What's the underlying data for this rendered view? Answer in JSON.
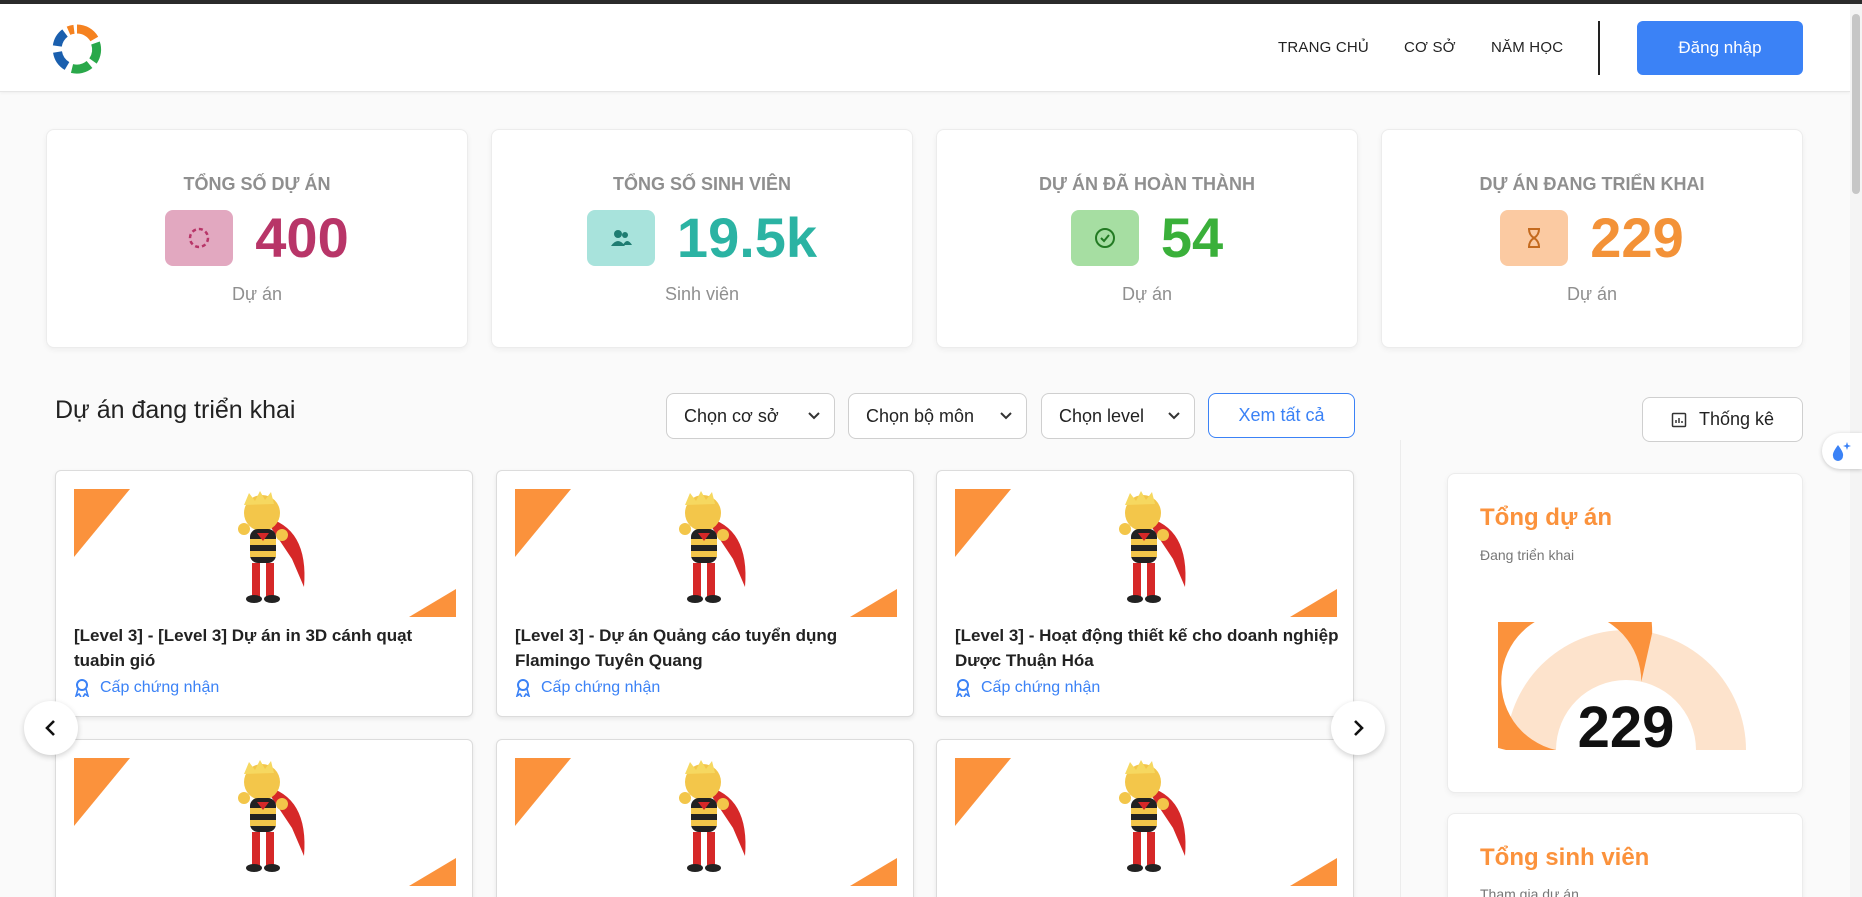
{
  "header": {
    "nav": [
      "TRANG CHỦ",
      "CƠ SỞ",
      "NĂM HỌC"
    ],
    "login_label": "Đăng nhập"
  },
  "stats": [
    {
      "title": "TỔNG SỐ DỰ ÁN",
      "value": "400",
      "unit": "Dự án",
      "icon": "spinner-icon",
      "color": "#b83568",
      "icon_bg": "#e2a8c0"
    },
    {
      "title": "TỔNG SỐ SINH VIÊN",
      "value": "19.5k",
      "unit": "Sinh viên",
      "icon": "users-icon",
      "color": "#2bb3a3",
      "icon_bg": "#a8e3dc"
    },
    {
      "title": "DỰ ÁN ĐÃ HOÀN THÀNH",
      "value": "54",
      "unit": "Dự án",
      "icon": "check-circle-icon",
      "color": "#3ab03a",
      "icon_bg": "#a6dea2"
    },
    {
      "title": "DỰ ÁN ĐANG TRIỂN KHAI",
      "value": "229",
      "unit": "Dự án",
      "icon": "hourglass-icon",
      "color": "#f39238",
      "icon_bg": "#fbcaa2"
    }
  ],
  "section": {
    "title": "Dự án đang triển khai",
    "filters": [
      "Chọn cơ sở",
      "Chọn bộ môn",
      "Chọn level"
    ],
    "view_all": "Xem tất cả",
    "stats_button": "Thống kê"
  },
  "projects": [
    {
      "title": "[Level 3] - [Level 3] Dự án in 3D cánh quạt tuabin gió",
      "cert": "Cấp chứng nhận"
    },
    {
      "title": "[Level 3] - Dự án Quảng cáo tuyển dụng Flamingo Tuyên Quang",
      "cert": "Cấp chứng nhận"
    },
    {
      "title": "[Level 3] - Hoạt động thiết kế cho doanh nghiệp Dược Thuận Hóa",
      "cert": "Cấp chứng nhận"
    }
  ],
  "side": {
    "card1": {
      "title": "Tổng dự án",
      "sub": "Đang triển khai",
      "value": "229",
      "fraction": 0.57
    },
    "card2": {
      "title": "Tổng sinh viên",
      "sub": "Tham gia dự án"
    }
  },
  "colors": {
    "accent": "#3b82f6",
    "orange": "#fb923c",
    "orange_light": "#fde3cc"
  }
}
